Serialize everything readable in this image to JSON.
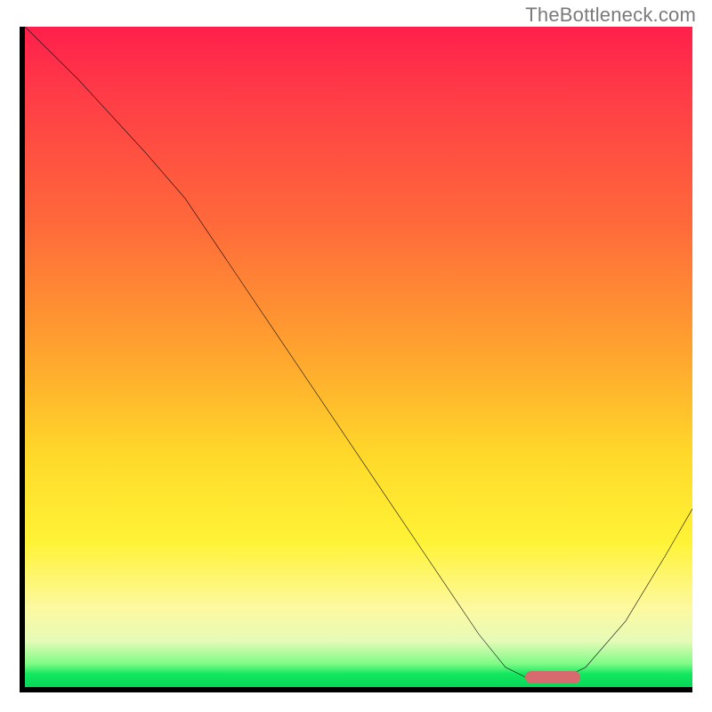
{
  "watermark": "TheBottleneck.com",
  "colors": {
    "axis": "#000000",
    "curve": "#000000",
    "marker": "#d66a6e",
    "gradient_top": "#ff1f4b",
    "gradient_mid": "#ffd92a",
    "gradient_bottom": "#06d657"
  },
  "chart_data": {
    "type": "line",
    "title": "",
    "xlabel": "",
    "ylabel": "",
    "xlim": [
      0,
      100
    ],
    "ylim": [
      0,
      100
    ],
    "grid": false,
    "x": [
      0,
      8,
      18,
      24,
      30,
      40,
      50,
      60,
      68,
      72,
      76,
      80,
      84,
      90,
      96,
      100
    ],
    "values": [
      100,
      92,
      81,
      74,
      65,
      50,
      35,
      20,
      8,
      3,
      1,
      1,
      3,
      10,
      20,
      27
    ],
    "comment": "y is a qualitative 'bottleneck %' read off the vertical position; 0 = green bottom, 100 = red top. Curve descends, slight knee ~x=24, reaches ~0 around x=76-80, then rises.",
    "series": [
      {
        "name": "bottleneck-curve",
        "x": [
          0,
          8,
          18,
          24,
          30,
          40,
          50,
          60,
          68,
          72,
          76,
          80,
          84,
          90,
          96,
          100
        ],
        "values": [
          100,
          92,
          81,
          74,
          65,
          50,
          35,
          20,
          8,
          3,
          1,
          1,
          3,
          10,
          20,
          27
        ]
      }
    ],
    "annotations": [
      {
        "name": "optimal-marker",
        "x_center": 79,
        "y": 1,
        "shape": "pill",
        "color": "#d66a6e"
      }
    ]
  }
}
